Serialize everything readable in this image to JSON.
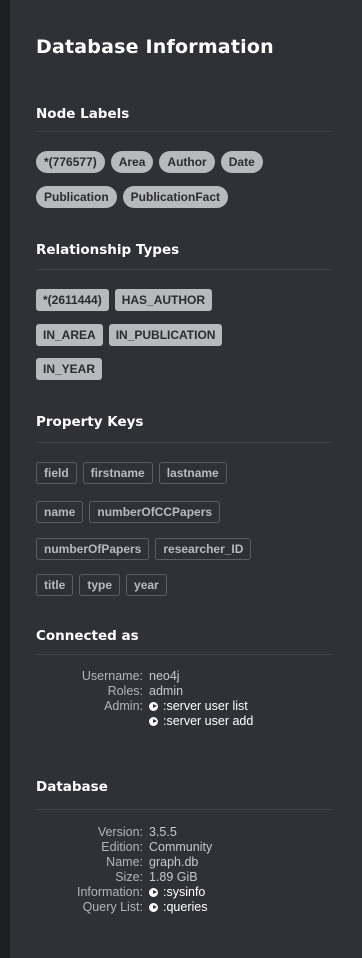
{
  "panel": {
    "title": "Database Information"
  },
  "node_labels": {
    "heading": "Node Labels",
    "items": [
      "*(776577)",
      "Area",
      "Author",
      "Date",
      "Publication",
      "PublicationFact"
    ]
  },
  "relationship_types": {
    "heading": "Relationship Types",
    "items": [
      "*(2611444)",
      "HAS_AUTHOR",
      "IN_AREA",
      "IN_PUBLICATION",
      "IN_YEAR"
    ]
  },
  "property_keys": {
    "heading": "Property Keys",
    "items": [
      "field",
      "firstname",
      "lastname",
      "name",
      "numberOfCCPapers",
      "numberOfPapers",
      "researcher_ID",
      "title",
      "type",
      "year"
    ]
  },
  "connected_as": {
    "heading": "Connected as",
    "username_label": "Username:",
    "username": "neo4j",
    "roles_label": "Roles:",
    "roles": "admin",
    "admin_label": "Admin:",
    "admin_commands": [
      ":server user list",
      ":server user add"
    ]
  },
  "database": {
    "heading": "Database",
    "version_label": "Version:",
    "version": "3.5.5",
    "edition_label": "Edition:",
    "edition": "Community",
    "name_label": "Name:",
    "name": "graph.db",
    "size_label": "Size:",
    "size": "1.89 GiB",
    "information_label": "Information:",
    "information_command": ":sysinfo",
    "query_list_label": "Query List:",
    "query_list_command": ":queries"
  },
  "colors": {
    "panel_bg": "#2f3136",
    "chip_bg": "#b8b9bc",
    "heading": "#ffffff"
  }
}
